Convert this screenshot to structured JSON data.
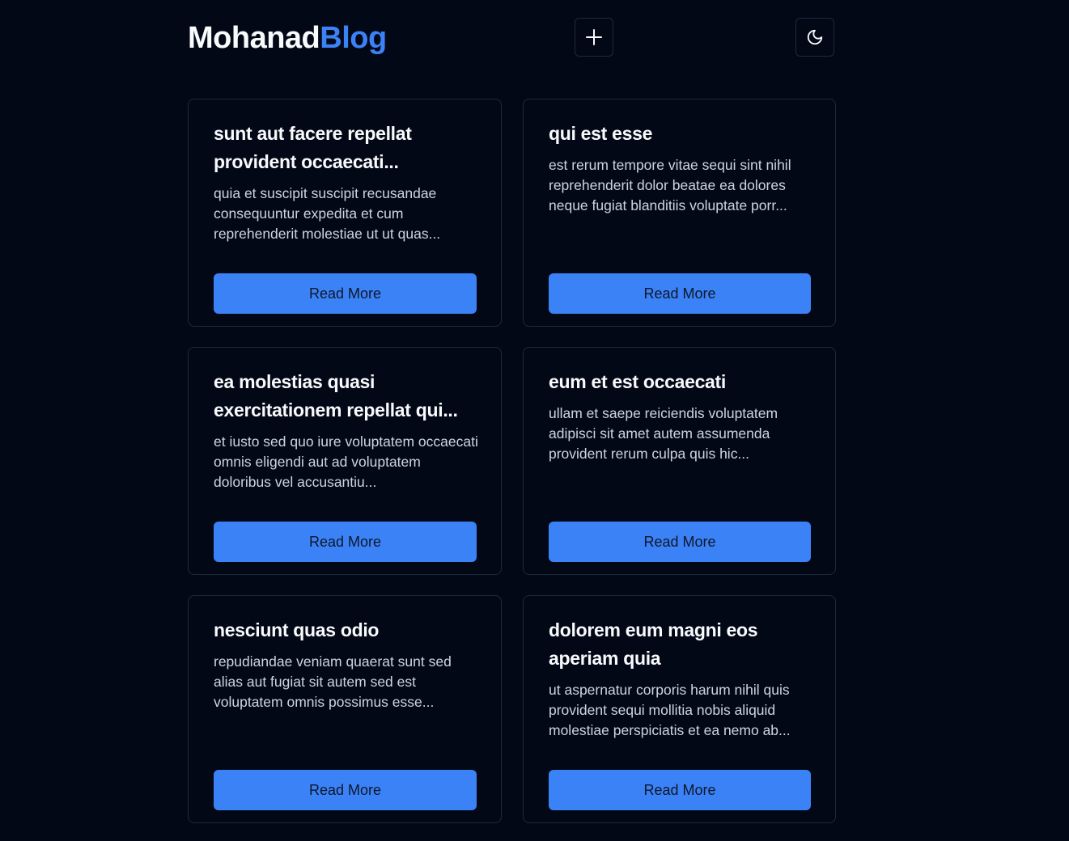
{
  "header": {
    "logo_main": "Mohanad",
    "logo_accent": "Blog",
    "add_icon": "plus-icon",
    "theme_icon": "moon-icon"
  },
  "colors": {
    "background": "#030817",
    "accent": "#3b82f6",
    "border": "#1e293b"
  },
  "posts": [
    {
      "title": "sunt aut facere repellat provident occaecati...",
      "body": "quia et suscipit suscipit recusandae consequuntur expedita et cum reprehenderit molestiae ut ut quas...",
      "button": "Read More"
    },
    {
      "title": "qui est esse",
      "body": "est rerum tempore vitae sequi sint nihil reprehenderit dolor beatae ea dolores neque fugiat blanditiis voluptate porr...",
      "button": "Read More"
    },
    {
      "title": "ea molestias quasi exercitationem repellat qui...",
      "body": "et iusto sed quo iure voluptatem occaecati omnis eligendi aut ad voluptatem doloribus vel accusantiu...",
      "button": "Read More"
    },
    {
      "title": "eum et est occaecati",
      "body": "ullam et saepe reiciendis voluptatem adipisci sit amet autem assumenda provident rerum culpa quis hic...",
      "button": "Read More"
    },
    {
      "title": "nesciunt quas odio",
      "body": "repudiandae veniam quaerat sunt sed alias aut fugiat sit autem sed est voluptatem omnis possimus esse...",
      "button": "Read More"
    },
    {
      "title": "dolorem eum magni eos aperiam quia",
      "body": "ut aspernatur corporis harum nihil quis provident sequi mollitia nobis aliquid molestiae perspiciatis et ea nemo ab...",
      "button": "Read More"
    }
  ]
}
